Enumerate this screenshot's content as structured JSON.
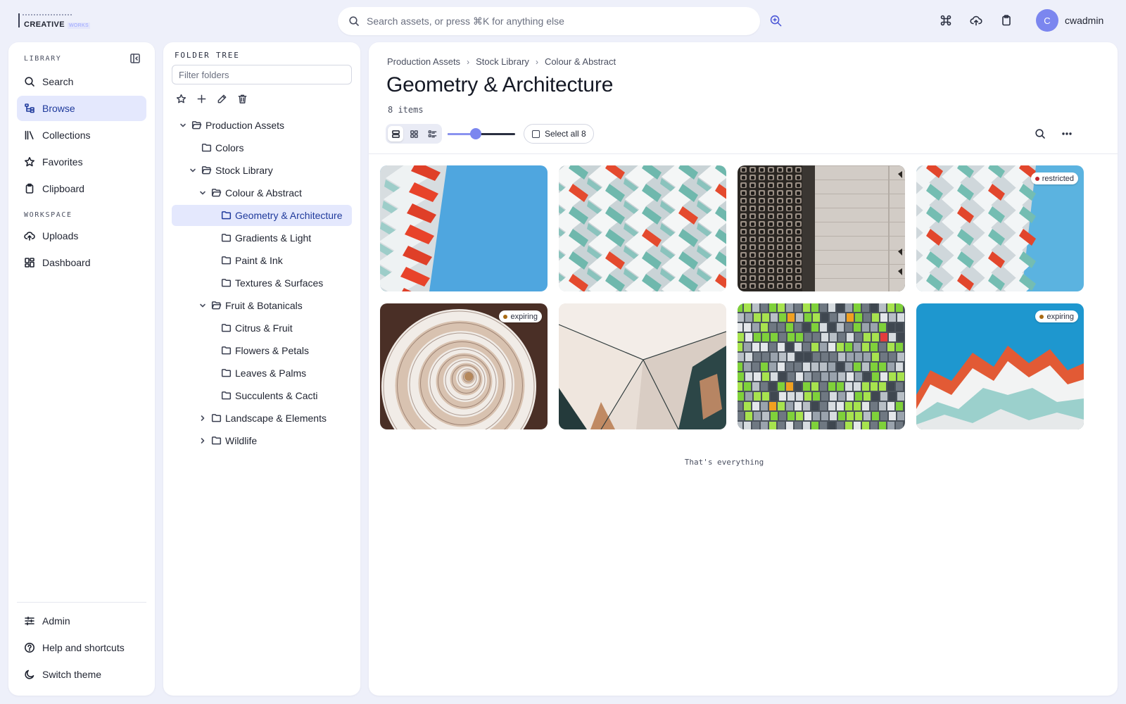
{
  "app": {
    "logo_main": "CREATIVE",
    "logo_sub": "WORKS"
  },
  "topbar": {
    "search_placeholder": "Search assets, or press ⌘K for anything else",
    "username": "cwadmin",
    "avatar_initial": "C",
    "icons": [
      "sparkle-search-icon",
      "command-icon",
      "upload-cloud-icon",
      "clipboard-icon"
    ]
  },
  "sidebar": {
    "library_label": "LIBRARY",
    "workspace_label": "WORKSPACE",
    "library_items": [
      {
        "label": "Search",
        "icon": "search-icon"
      },
      {
        "label": "Browse",
        "icon": "browse-tree-icon",
        "active": true
      },
      {
        "label": "Collections",
        "icon": "collections-icon"
      },
      {
        "label": "Favorites",
        "icon": "star-icon"
      },
      {
        "label": "Clipboard",
        "icon": "clipboard-icon"
      }
    ],
    "workspace_items": [
      {
        "label": "Uploads",
        "icon": "upload-cloud-icon"
      },
      {
        "label": "Dashboard",
        "icon": "dashboard-icon"
      }
    ],
    "footer_items": [
      {
        "label": "Admin",
        "icon": "sliders-icon"
      },
      {
        "label": "Help and shortcuts",
        "icon": "help-icon"
      },
      {
        "label": "Switch theme",
        "icon": "moon-icon"
      }
    ]
  },
  "folder_tree": {
    "title": "FOLDER TREE",
    "filter_placeholder": "Filter folders",
    "rows": [
      {
        "label": "Production Assets",
        "expanded": true
      },
      {
        "label": "Colors"
      },
      {
        "label": "Stock Library",
        "expanded": true
      },
      {
        "label": "Colour & Abstract",
        "expanded": true
      },
      {
        "label": "Geometry & Architecture",
        "active": true
      },
      {
        "label": "Gradients & Light"
      },
      {
        "label": "Paint & Ink"
      },
      {
        "label": "Textures & Surfaces"
      },
      {
        "label": "Fruit & Botanicals",
        "expanded": true
      },
      {
        "label": "Citrus & Fruit"
      },
      {
        "label": "Flowers & Petals"
      },
      {
        "label": "Leaves & Palms"
      },
      {
        "label": "Succulents & Cacti"
      },
      {
        "label": "Landscape & Elements",
        "expanded": false
      },
      {
        "label": "Wildlife",
        "expanded": false
      }
    ]
  },
  "main": {
    "breadcrumbs": [
      "Production Assets",
      "Stock Library",
      "Colour & Abstract"
    ],
    "title": "Geometry & Architecture",
    "count": "8 items",
    "select_all": "Select all 8",
    "thumb_size": 0.42,
    "end_note": "That's everything",
    "badge_colors": {
      "restricted": "#c0262d",
      "expiring": "#a86a14"
    },
    "assets": [
      {
        "image": "balconies-red-sky",
        "badge": ""
      },
      {
        "image": "balconies-teal-red",
        "badge": ""
      },
      {
        "image": "concrete-towers",
        "badge": ""
      },
      {
        "image": "balconies-red-pattern",
        "badge": "restricted"
      },
      {
        "image": "spiral-staircase",
        "badge": "expiring"
      },
      {
        "image": "glass-facets",
        "badge": ""
      },
      {
        "image": "colorful-windows",
        "badge": ""
      },
      {
        "image": "red-balcony-tower",
        "badge": "expiring"
      }
    ]
  }
}
